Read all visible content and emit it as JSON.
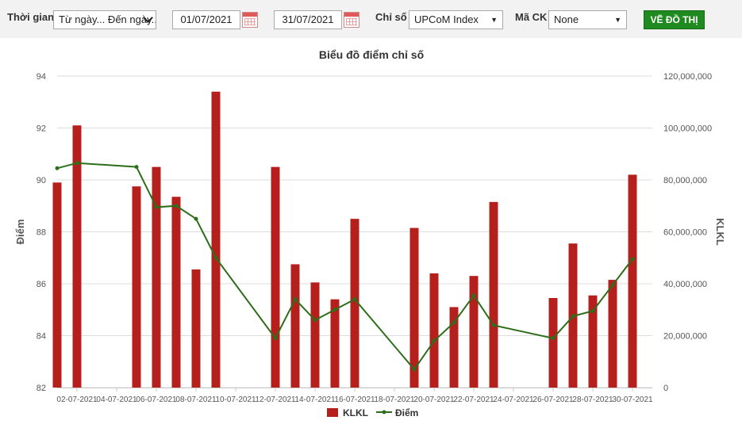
{
  "toolbar": {
    "time_label": "Thời gian",
    "time_range_value": "Từ ngày... Đến ngày...",
    "from_date": "01/07/2021",
    "to_date": "31/07/2021",
    "index_label": "Chỉ số",
    "index_value": "UPCoM Index",
    "stock_label": "Mã CK",
    "stock_value": "None",
    "draw_button": "VẼ ĐỒ THỊ"
  },
  "colors": {
    "bar": "#b5201d",
    "line": "#2d6e1a",
    "button": "#1f8a1f"
  },
  "chart_data": {
    "type": "bar",
    "title": "Biểu đồ điểm chỉ số",
    "ylabel_left": "Điểm",
    "ylabel_right": "KLKL",
    "ylim_left": [
      82,
      94
    ],
    "yticks_left": [
      82,
      84,
      86,
      88,
      90,
      92,
      94
    ],
    "ylim_right": [
      0,
      120000000
    ],
    "yticks_right": [
      0,
      20000000,
      40000000,
      60000000,
      80000000,
      100000000,
      120000000
    ],
    "ytick_labels_right": [
      "0",
      "20,000,000",
      "40,000,000",
      "60,000,000",
      "80,000,000",
      "100,000,000",
      "120,000,000"
    ],
    "x_range": [
      1,
      31
    ],
    "xtick_days": [
      2,
      4,
      6,
      8,
      10,
      12,
      14,
      16,
      18,
      20,
      22,
      24,
      26,
      28,
      30
    ],
    "xtick_labels": [
      "02-07-2021",
      "04-07-2021",
      "06-07-2021",
      "08-07-2021",
      "10-07-2021",
      "12-07-2021",
      "14-07-2021",
      "16-07-2021",
      "18-07-2021",
      "20-07-2021",
      "22-07-2021",
      "24-07-2021",
      "26-07-2021",
      "28-07-2021",
      "30-07-2021"
    ],
    "grid": true,
    "legend_position": "bottom",
    "series": [
      {
        "name": "KLKL",
        "type": "bar",
        "axis": "right",
        "x": [
          "01-07-2021",
          "02-07-2021",
          "05-07-2021",
          "06-07-2021",
          "07-07-2021",
          "08-07-2021",
          "09-07-2021",
          "12-07-2021",
          "13-07-2021",
          "14-07-2021",
          "15-07-2021",
          "16-07-2021",
          "19-07-2021",
          "20-07-2021",
          "21-07-2021",
          "22-07-2021",
          "23-07-2021",
          "26-07-2021",
          "27-07-2021",
          "28-07-2021",
          "29-07-2021",
          "30-07-2021"
        ],
        "values": [
          79000000,
          101000000,
          77500000,
          85000000,
          73500000,
          45500000,
          114000000,
          85000000,
          47500000,
          40500000,
          34000000,
          65000000,
          61500000,
          44000000,
          31000000,
          43000000,
          71500000,
          34500000,
          55500000,
          35500000,
          41500000,
          82000000
        ]
      },
      {
        "name": "Điểm",
        "type": "line",
        "axis": "left",
        "x": [
          "01-07-2021",
          "02-07-2021",
          "05-07-2021",
          "06-07-2021",
          "07-07-2021",
          "08-07-2021",
          "09-07-2021",
          "12-07-2021",
          "13-07-2021",
          "14-07-2021",
          "15-07-2021",
          "16-07-2021",
          "19-07-2021",
          "20-07-2021",
          "21-07-2021",
          "22-07-2021",
          "23-07-2021",
          "26-07-2021",
          "27-07-2021",
          "28-07-2021",
          "29-07-2021",
          "30-07-2021"
        ],
        "values": [
          90.45,
          90.65,
          90.5,
          88.95,
          89.0,
          88.5,
          87.0,
          83.9,
          85.4,
          84.6,
          85.0,
          85.4,
          82.7,
          83.8,
          84.5,
          85.55,
          84.4,
          83.9,
          84.75,
          84.95,
          85.95,
          86.95
        ]
      }
    ]
  }
}
